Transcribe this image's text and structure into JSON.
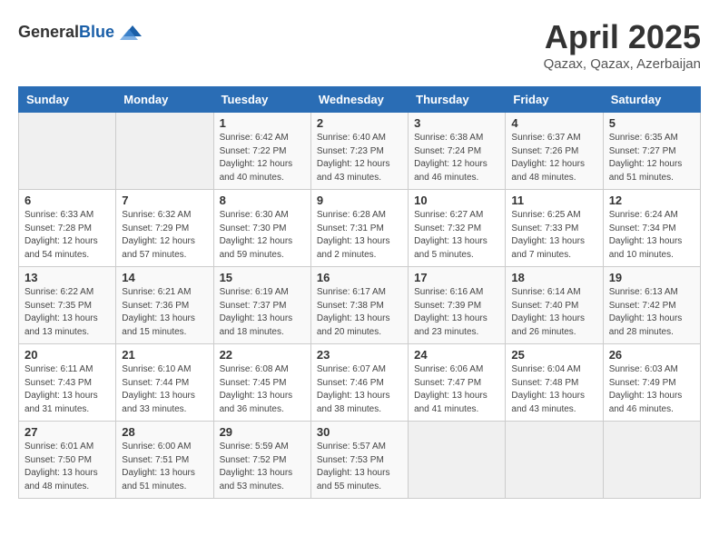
{
  "header": {
    "logo_general": "General",
    "logo_blue": "Blue",
    "month_year": "April 2025",
    "location": "Qazax, Qazax, Azerbaijan"
  },
  "weekdays": [
    "Sunday",
    "Monday",
    "Tuesday",
    "Wednesday",
    "Thursday",
    "Friday",
    "Saturday"
  ],
  "weeks": [
    [
      {
        "day": "",
        "sunrise": "",
        "sunset": "",
        "daylight": ""
      },
      {
        "day": "",
        "sunrise": "",
        "sunset": "",
        "daylight": ""
      },
      {
        "day": "1",
        "sunrise": "Sunrise: 6:42 AM",
        "sunset": "Sunset: 7:22 PM",
        "daylight": "Daylight: 12 hours and 40 minutes."
      },
      {
        "day": "2",
        "sunrise": "Sunrise: 6:40 AM",
        "sunset": "Sunset: 7:23 PM",
        "daylight": "Daylight: 12 hours and 43 minutes."
      },
      {
        "day": "3",
        "sunrise": "Sunrise: 6:38 AM",
        "sunset": "Sunset: 7:24 PM",
        "daylight": "Daylight: 12 hours and 46 minutes."
      },
      {
        "day": "4",
        "sunrise": "Sunrise: 6:37 AM",
        "sunset": "Sunset: 7:26 PM",
        "daylight": "Daylight: 12 hours and 48 minutes."
      },
      {
        "day": "5",
        "sunrise": "Sunrise: 6:35 AM",
        "sunset": "Sunset: 7:27 PM",
        "daylight": "Daylight: 12 hours and 51 minutes."
      }
    ],
    [
      {
        "day": "6",
        "sunrise": "Sunrise: 6:33 AM",
        "sunset": "Sunset: 7:28 PM",
        "daylight": "Daylight: 12 hours and 54 minutes."
      },
      {
        "day": "7",
        "sunrise": "Sunrise: 6:32 AM",
        "sunset": "Sunset: 7:29 PM",
        "daylight": "Daylight: 12 hours and 57 minutes."
      },
      {
        "day": "8",
        "sunrise": "Sunrise: 6:30 AM",
        "sunset": "Sunset: 7:30 PM",
        "daylight": "Daylight: 12 hours and 59 minutes."
      },
      {
        "day": "9",
        "sunrise": "Sunrise: 6:28 AM",
        "sunset": "Sunset: 7:31 PM",
        "daylight": "Daylight: 13 hours and 2 minutes."
      },
      {
        "day": "10",
        "sunrise": "Sunrise: 6:27 AM",
        "sunset": "Sunset: 7:32 PM",
        "daylight": "Daylight: 13 hours and 5 minutes."
      },
      {
        "day": "11",
        "sunrise": "Sunrise: 6:25 AM",
        "sunset": "Sunset: 7:33 PM",
        "daylight": "Daylight: 13 hours and 7 minutes."
      },
      {
        "day": "12",
        "sunrise": "Sunrise: 6:24 AM",
        "sunset": "Sunset: 7:34 PM",
        "daylight": "Daylight: 13 hours and 10 minutes."
      }
    ],
    [
      {
        "day": "13",
        "sunrise": "Sunrise: 6:22 AM",
        "sunset": "Sunset: 7:35 PM",
        "daylight": "Daylight: 13 hours and 13 minutes."
      },
      {
        "day": "14",
        "sunrise": "Sunrise: 6:21 AM",
        "sunset": "Sunset: 7:36 PM",
        "daylight": "Daylight: 13 hours and 15 minutes."
      },
      {
        "day": "15",
        "sunrise": "Sunrise: 6:19 AM",
        "sunset": "Sunset: 7:37 PM",
        "daylight": "Daylight: 13 hours and 18 minutes."
      },
      {
        "day": "16",
        "sunrise": "Sunrise: 6:17 AM",
        "sunset": "Sunset: 7:38 PM",
        "daylight": "Daylight: 13 hours and 20 minutes."
      },
      {
        "day": "17",
        "sunrise": "Sunrise: 6:16 AM",
        "sunset": "Sunset: 7:39 PM",
        "daylight": "Daylight: 13 hours and 23 minutes."
      },
      {
        "day": "18",
        "sunrise": "Sunrise: 6:14 AM",
        "sunset": "Sunset: 7:40 PM",
        "daylight": "Daylight: 13 hours and 26 minutes."
      },
      {
        "day": "19",
        "sunrise": "Sunrise: 6:13 AM",
        "sunset": "Sunset: 7:42 PM",
        "daylight": "Daylight: 13 hours and 28 minutes."
      }
    ],
    [
      {
        "day": "20",
        "sunrise": "Sunrise: 6:11 AM",
        "sunset": "Sunset: 7:43 PM",
        "daylight": "Daylight: 13 hours and 31 minutes."
      },
      {
        "day": "21",
        "sunrise": "Sunrise: 6:10 AM",
        "sunset": "Sunset: 7:44 PM",
        "daylight": "Daylight: 13 hours and 33 minutes."
      },
      {
        "day": "22",
        "sunrise": "Sunrise: 6:08 AM",
        "sunset": "Sunset: 7:45 PM",
        "daylight": "Daylight: 13 hours and 36 minutes."
      },
      {
        "day": "23",
        "sunrise": "Sunrise: 6:07 AM",
        "sunset": "Sunset: 7:46 PM",
        "daylight": "Daylight: 13 hours and 38 minutes."
      },
      {
        "day": "24",
        "sunrise": "Sunrise: 6:06 AM",
        "sunset": "Sunset: 7:47 PM",
        "daylight": "Daylight: 13 hours and 41 minutes."
      },
      {
        "day": "25",
        "sunrise": "Sunrise: 6:04 AM",
        "sunset": "Sunset: 7:48 PM",
        "daylight": "Daylight: 13 hours and 43 minutes."
      },
      {
        "day": "26",
        "sunrise": "Sunrise: 6:03 AM",
        "sunset": "Sunset: 7:49 PM",
        "daylight": "Daylight: 13 hours and 46 minutes."
      }
    ],
    [
      {
        "day": "27",
        "sunrise": "Sunrise: 6:01 AM",
        "sunset": "Sunset: 7:50 PM",
        "daylight": "Daylight: 13 hours and 48 minutes."
      },
      {
        "day": "28",
        "sunrise": "Sunrise: 6:00 AM",
        "sunset": "Sunset: 7:51 PM",
        "daylight": "Daylight: 13 hours and 51 minutes."
      },
      {
        "day": "29",
        "sunrise": "Sunrise: 5:59 AM",
        "sunset": "Sunset: 7:52 PM",
        "daylight": "Daylight: 13 hours and 53 minutes."
      },
      {
        "day": "30",
        "sunrise": "Sunrise: 5:57 AM",
        "sunset": "Sunset: 7:53 PM",
        "daylight": "Daylight: 13 hours and 55 minutes."
      },
      {
        "day": "",
        "sunrise": "",
        "sunset": "",
        "daylight": ""
      },
      {
        "day": "",
        "sunrise": "",
        "sunset": "",
        "daylight": ""
      },
      {
        "day": "",
        "sunrise": "",
        "sunset": "",
        "daylight": ""
      }
    ]
  ]
}
